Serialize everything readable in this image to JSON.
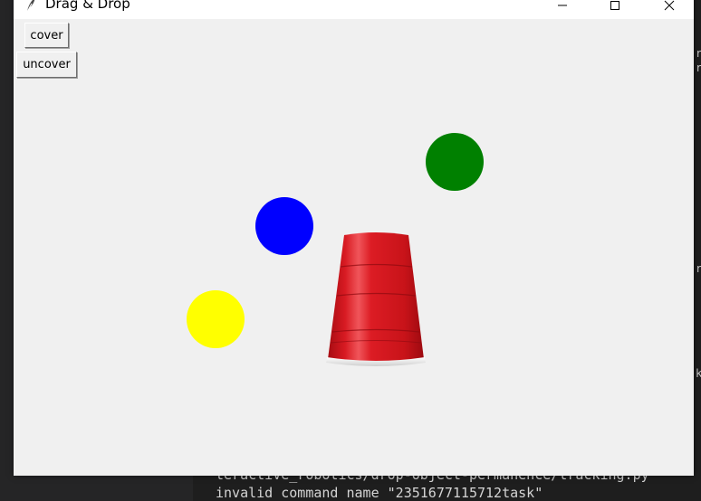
{
  "window": {
    "title": "Drag & Drop",
    "min_glyph": "—",
    "max_glyph": "☐",
    "close_glyph": "✕"
  },
  "toolbar": {
    "cover_label": "cover",
    "uncover_label": "uncover"
  },
  "balls": [
    {
      "name": "green-ball",
      "color": "#008000"
    },
    {
      "name": "blue-ball",
      "color": "#0000ff"
    },
    {
      "name": "yellow-ball",
      "color": "#ffff00"
    }
  ],
  "cup": {
    "name": "red-cup",
    "color": "#d3141c"
  },
  "terminal": {
    "line1": "teractive_robotics/drop-object-permanence/tracking.py",
    "line2": "invalid command name \"2351677115712task\""
  },
  "edge_marks": [
    "r",
    "r",
    "r",
    "k"
  ]
}
